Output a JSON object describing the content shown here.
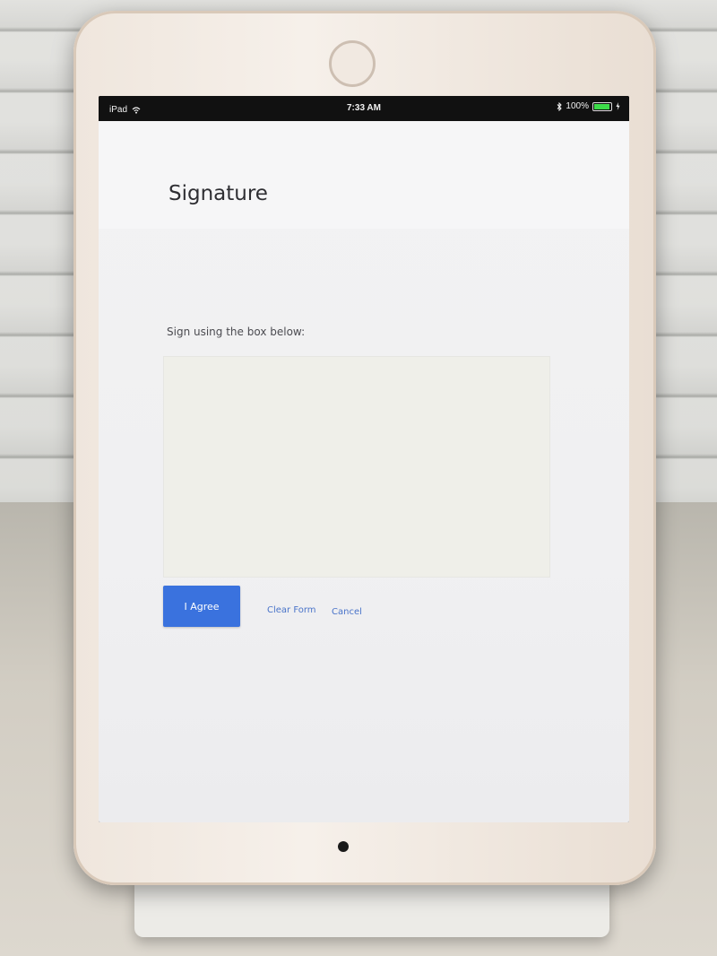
{
  "status_bar": {
    "device": "iPad",
    "time": "7:33 AM",
    "battery_percent": "100%",
    "battery_level": 1.0
  },
  "page": {
    "title": "Signature",
    "instruction": "Sign using the box below:"
  },
  "actions": {
    "agree_label": "I Agree",
    "clear_label": "Clear Form",
    "cancel_label": "Cancel"
  },
  "colors": {
    "primary_button": "#3a72de",
    "link": "#4a74c9"
  },
  "icons": [
    "wifi-icon",
    "bluetooth-icon",
    "battery-icon",
    "charging-icon"
  ]
}
